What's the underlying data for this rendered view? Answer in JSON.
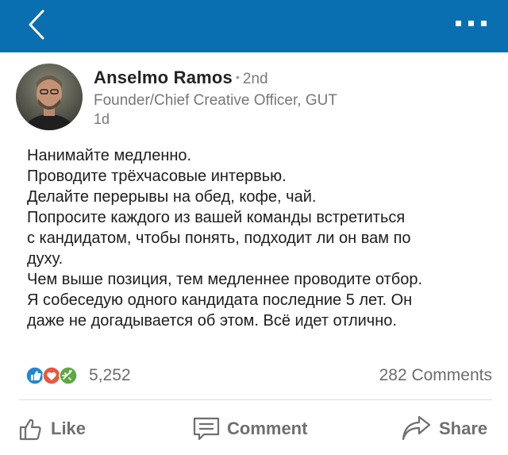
{
  "colors": {
    "brand": "#0a6fb0",
    "text": "#1d1d1d",
    "muted": "#777777"
  },
  "topbar": {
    "back_icon": "chevron-left-icon",
    "more_icon": "more-horizontal-icon"
  },
  "author": {
    "name": "Anselmo Ramos",
    "degree": "2nd",
    "headline": "Founder/Chief Creative Officer, GUT",
    "time": "1d"
  },
  "post": {
    "lines": [
      "Нанимайте медленно.",
      "Проводите трёхчасовые интервью.",
      "Делайте перерывы на обед, кофе, чай.",
      "Попросите каждого из вашей команды встретиться",
      "с кандидатом, чтобы понять, подходит ли он вам по",
      "духу.",
      "Чем выше позиция, тем медленнее проводите отбор.",
      "Я собеседую одного кандидата последние 5 лет. Он",
      "даже не догадывается об этом. Всё идет отлично."
    ]
  },
  "social": {
    "reaction_icons": [
      "like-icon",
      "love-icon",
      "celebrate-icon"
    ],
    "reactions_count": "5,252",
    "comments_count": "282 Comments"
  },
  "actions": {
    "like": "Like",
    "comment": "Comment",
    "share": "Share"
  }
}
